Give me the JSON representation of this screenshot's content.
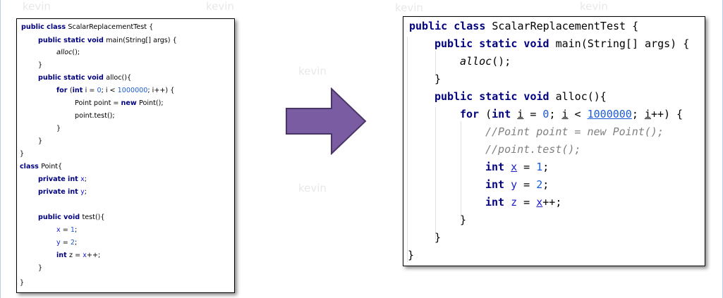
{
  "left_code": {
    "l1": {
      "a": "public class ",
      "b": "ScalarReplacementTest {"
    },
    "l2": {
      "a": "public static void ",
      "b": "main(String[] args) {"
    },
    "l3": {
      "a": "alloc",
      "b": "();"
    },
    "l4": "}",
    "l5": {
      "a": "public static void ",
      "b": "alloc(){"
    },
    "l6": {
      "a": "for ",
      "b": "(",
      "c": "int ",
      "d": "i = ",
      "e": "0",
      "f": "; i < ",
      "g": "1000000",
      "h": "; i++) {"
    },
    "l7": {
      "a": "Point point = ",
      "b": "new ",
      "c": "Point();"
    },
    "l8": "point.test();",
    "l9": "}",
    "l10": "}",
    "l11": "}",
    "l12": {
      "a": "class ",
      "b": "Point{"
    },
    "l13": {
      "a": "private int ",
      "b": "x",
      "c": ";"
    },
    "l14": {
      "a": "private int ",
      "b": "y",
      "c": ";"
    },
    "l15": {
      "a": "public void ",
      "b": "test(){"
    },
    "l16": {
      "a": "x",
      "b": " = ",
      "c": "1",
      "d": ";"
    },
    "l17": {
      "a": "y",
      "b": " = ",
      "c": "2",
      "d": ";"
    },
    "l18": {
      "a": "int ",
      "b": "z = ",
      "c": "x",
      "d": "++;"
    },
    "l19": "}",
    "l20": "}"
  },
  "right_code": {
    "l1": {
      "a": "public class ",
      "b": "ScalarReplacementTest {"
    },
    "l2": {
      "a": "public static void ",
      "b": "main(String[] args) {"
    },
    "l3": {
      "a": "alloc",
      "b": "();"
    },
    "l4": "}",
    "l5": {
      "a": "public static void ",
      "b": "alloc(){"
    },
    "l6": {
      "a": "for ",
      "b": "(",
      "c": "int ",
      "d": "i",
      "e": " = ",
      "f": "0",
      "g": "; ",
      "h": "i",
      "i": " < ",
      "j": "1000000",
      "k": "; ",
      "l": "i",
      "m": "++) {"
    },
    "l7": "//Point point = new Point();",
    "l8": "//point.test();",
    "l9": {
      "a": "int ",
      "b": "x",
      "c": " = ",
      "d": "1",
      "e": ";"
    },
    "l10": {
      "a": "int ",
      "b": "y",
      "c": " = ",
      "d": "2",
      "e": ";"
    },
    "l11": {
      "a": "int ",
      "b": "z",
      "c": " = ",
      "d": "x",
      "e": "++;"
    },
    "l12": "}",
    "l13": "}",
    "l14": "}"
  },
  "watermark_text": "kevin",
  "colors": {
    "keyword": "#00007f",
    "number": "#1a5bd6",
    "field": "#1c1cc8",
    "comment": "#808080",
    "arrow_fill": "#7a5ca3",
    "arrow_stroke": "#4b3566"
  },
  "icons": {
    "transform_arrow": "right-arrow-icon"
  }
}
